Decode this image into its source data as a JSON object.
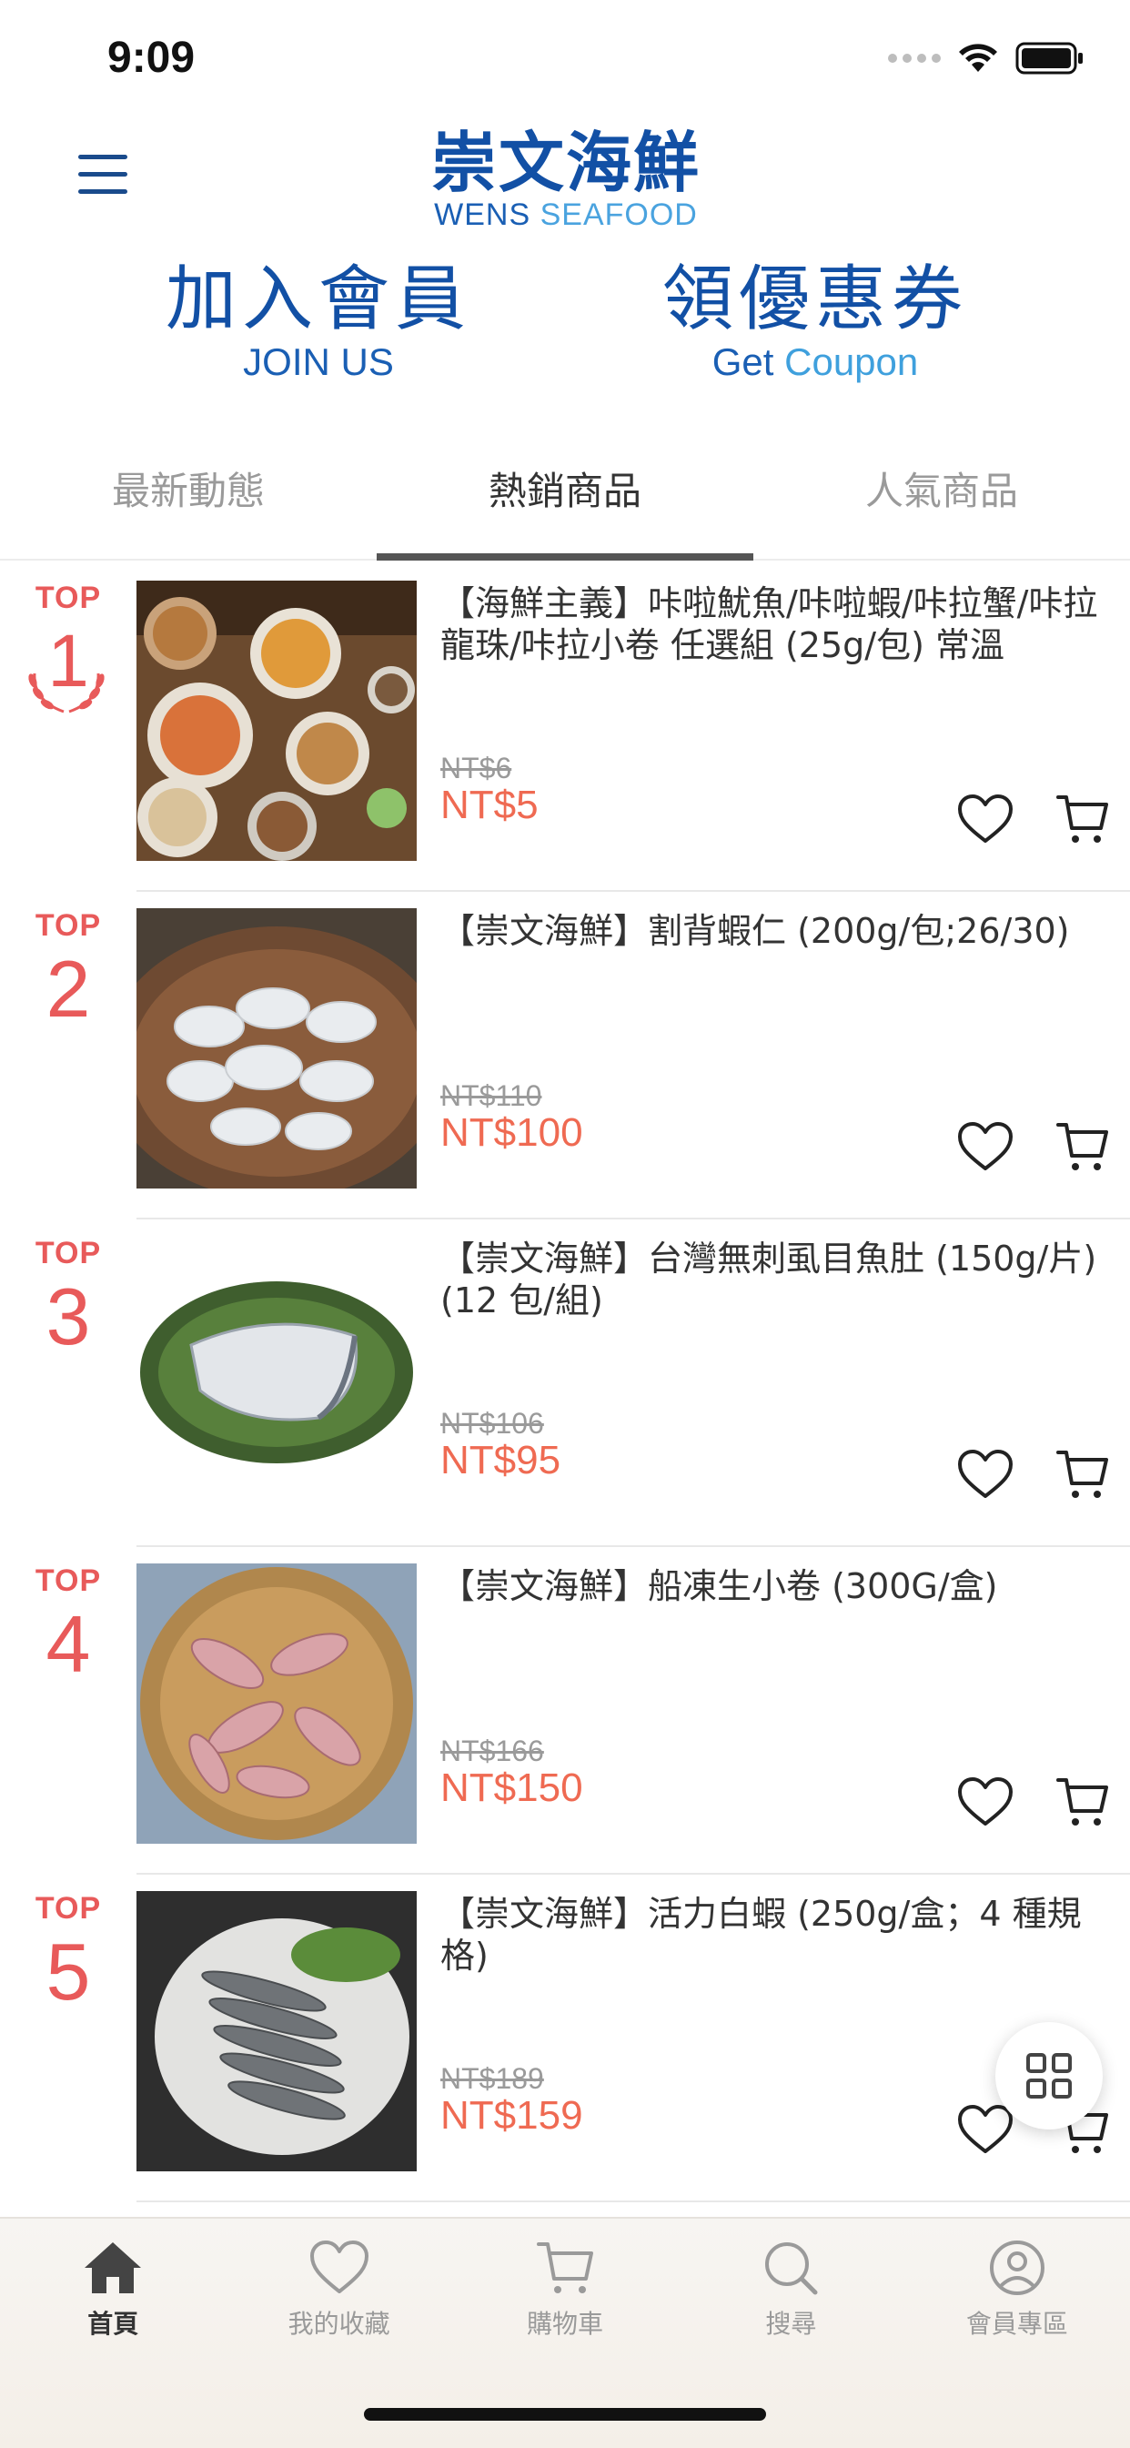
{
  "status_bar": {
    "time": "9:09"
  },
  "header": {
    "logo_cn": "崇文海鮮",
    "logo_en_bold": "WENS",
    "logo_en_light": "SEAFOOD"
  },
  "promos": [
    {
      "cn": "加入會員",
      "en_a": "JOIN US",
      "en_b": ""
    },
    {
      "cn": "領優惠券",
      "en_a": "Get",
      "en_b": "Coupon"
    }
  ],
  "tabs": [
    "最新動態",
    "熱銷商品",
    "人氣商品"
  ],
  "active_tab": "熱銷商品",
  "rank_prefix": "TOP",
  "products": [
    {
      "rank": "1",
      "title": "【海鮮主義】咔啦魷魚/咔啦蝦/咔拉蟹/咔拉龍珠/咔拉小卷 任選組 (25g/包) 常溫",
      "old_price": "NT$6",
      "price": "NT$5"
    },
    {
      "rank": "2",
      "title": "【崇文海鮮】割背蝦仁 (200g/包;26/30)",
      "old_price": "NT$110",
      "price": "NT$100"
    },
    {
      "rank": "3",
      "title": "【崇文海鮮】台灣無刺虱目魚肚 (150g/片)(12 包/組)",
      "old_price": "NT$106",
      "price": "NT$95"
    },
    {
      "rank": "4",
      "title": "【崇文海鮮】船凍生小卷 (300G/盒)",
      "old_price": "NT$166",
      "price": "NT$150"
    },
    {
      "rank": "5",
      "title": "【崇文海鮮】活力白蝦 (250g/盒；4 種規格)",
      "old_price": "NT$189",
      "price": "NT$159"
    }
  ],
  "bottom_nav": [
    {
      "label": "首頁",
      "icon": "home-icon",
      "active": true
    },
    {
      "label": "我的收藏",
      "icon": "heart-icon",
      "active": false
    },
    {
      "label": "購物車",
      "icon": "cart-icon",
      "active": false
    },
    {
      "label": "搜尋",
      "icon": "search-icon",
      "active": false
    },
    {
      "label": "會員專區",
      "icon": "user-icon",
      "active": false
    }
  ],
  "colors": {
    "brand_blue": "#1250a5",
    "price_red": "#ef6a52",
    "rank_red": "#e85a5a"
  }
}
